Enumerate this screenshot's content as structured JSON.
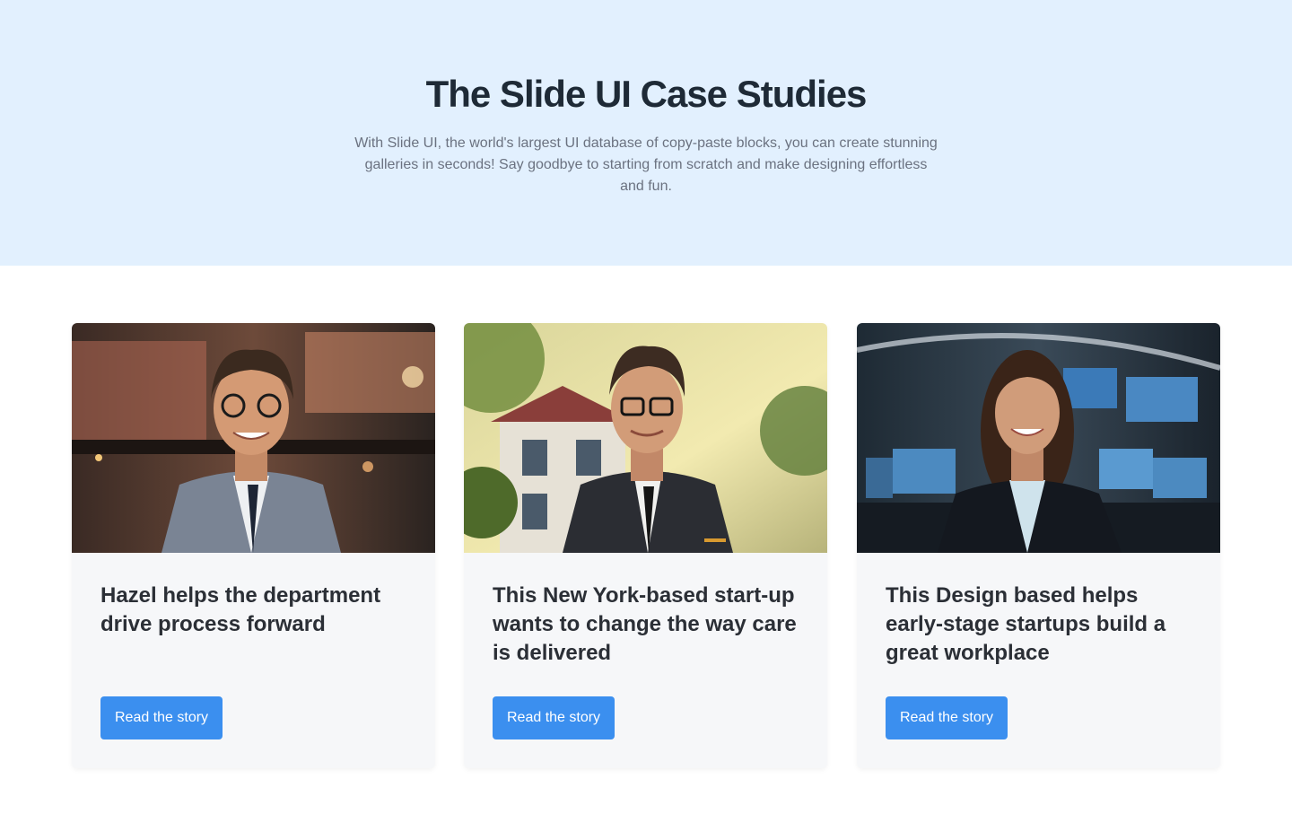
{
  "hero": {
    "title": "The Slide UI Case Studies",
    "subtitle": "With Slide UI, the world's largest UI database of copy-paste blocks, you can create stunning galleries in seconds! Say goodbye to starting from scratch and make designing effortless and fun.",
    "background_color": "#e2f0fe"
  },
  "cards": [
    {
      "title": "Hazel helps the department drive process forward",
      "button_label": "Read the story",
      "image": "portrait-man-glasses-grey-suit-photo"
    },
    {
      "title": "This New York-based start-up wants to change the way care is delivered",
      "button_label": "Read the story",
      "image": "portrait-man-glasses-dark-suit-outdoor-photo"
    },
    {
      "title": "This Design based helps early-stage startups build a great workplace",
      "button_label": "Read the story",
      "image": "portrait-woman-office-monitors-photo"
    }
  ],
  "colors": {
    "accent": "#3b8fef",
    "card_background": "#f6f7f9",
    "title_text": "#1e2a36",
    "muted_text": "#6b7280"
  }
}
